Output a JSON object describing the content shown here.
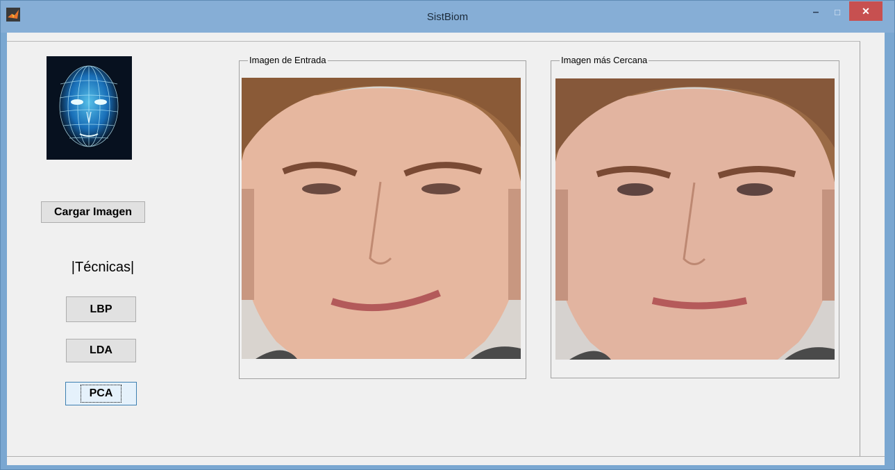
{
  "window": {
    "title": "SistBiom",
    "app_icon": "matlab-icon",
    "controls": {
      "minimize": "–",
      "maximize": "□",
      "close": "✕"
    }
  },
  "sidebar": {
    "logo_icon": "face-mesh-icon",
    "load_button": "Cargar Imagen",
    "techniques_label": "|Técnicas|",
    "buttons": [
      "LBP",
      "LDA",
      "PCA"
    ]
  },
  "panels": {
    "input": {
      "title": "Imagen de Entrada"
    },
    "closest": {
      "title": "Imagen más Cercana"
    }
  },
  "colors": {
    "titlebar": "#86aed6",
    "client_bg": "#f0f0f0",
    "close_button": "#c75050",
    "focus_border": "#3c7fb1"
  }
}
